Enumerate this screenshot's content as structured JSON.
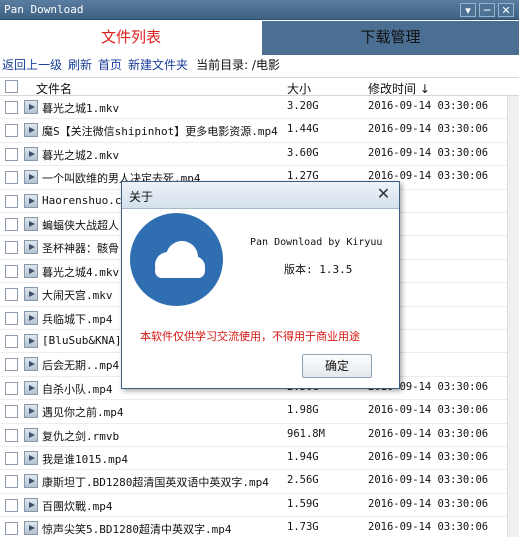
{
  "window": {
    "title": "Pan Download",
    "buttons": [
      "▾",
      "─",
      "✕"
    ]
  },
  "tabs": [
    {
      "label": "文件列表",
      "active": true
    },
    {
      "label": "下载管理",
      "active": false
    }
  ],
  "toolbar": {
    "links": [
      "返回上一级",
      "刷新",
      "首页",
      "新建文件夹"
    ],
    "current_dir_label": "当前目录: /电影"
  },
  "table": {
    "columns": [
      "文件名",
      "大小",
      "修改时间 ↓"
    ],
    "rows": [
      {
        "name": "暮光之城1.mkv",
        "size": "3.20G",
        "time": "2016-09-14 03:30:06"
      },
      {
        "name": "魔S【关注微信shipinhot】更多电影资源.mp4",
        "size": "1.44G",
        "time": "2016-09-14 03:30:06"
      },
      {
        "name": "暮光之城2.mkv",
        "size": "3.60G",
        "time": "2016-09-14 03:30:06"
      },
      {
        "name": "一个叫欧维的男人决定去死.mp4",
        "size": "1.27G",
        "time": "2016-09-14 03:30:06"
      },
      {
        "name": "Haorenshuo.co",
        "size": "",
        "time": ""
      },
      {
        "name": "蝙蝠侠大战超人",
        "size": "",
        "time": ""
      },
      {
        "name": "圣杯神器：骸骨",
        "size": "",
        "time": ""
      },
      {
        "name": "暮光之城4.mkv",
        "size": "",
        "time": ""
      },
      {
        "name": "大闹天宫.mkv",
        "size": "",
        "time": ""
      },
      {
        "name": "兵临城下.mp4",
        "size": "",
        "time": ""
      },
      {
        "name": "[BluSub&KNA]",
        "size": "",
        "time": ""
      },
      {
        "name": "后会无期..mp4",
        "size": "",
        "time": ""
      },
      {
        "name": "自杀小队.mp4",
        "size": "2.36G",
        "time": "2016-09-14 03:30:06"
      },
      {
        "name": "遇见你之前.mp4",
        "size": "1.98G",
        "time": "2016-09-14 03:30:06"
      },
      {
        "name": "复仇之剑.rmvb",
        "size": "961.8M",
        "time": "2016-09-14 03:30:06"
      },
      {
        "name": "我是谁1015.mp4",
        "size": "1.94G",
        "time": "2016-09-14 03:30:06"
      },
      {
        "name": "康斯坦丁.BD1280超清国英双语中英双字.mp4",
        "size": "2.56G",
        "time": "2016-09-14 03:30:06"
      },
      {
        "name": "百團炊戰.mp4",
        "size": "1.59G",
        "time": "2016-09-14 03:30:06"
      },
      {
        "name": "惊声尖笑5.BD1280超清中英双字.mp4",
        "size": "1.73G",
        "time": "2016-09-14 03:30:06"
      }
    ]
  },
  "about_dialog": {
    "title": "关于",
    "app_line": "Pan Download by Kiryuu",
    "version_line": "版本: 1.3.5",
    "warning": "本软件仅供学习交流使用，不得用于商业用途",
    "ok_label": "确定",
    "logo_color": "#2f6fb1"
  }
}
